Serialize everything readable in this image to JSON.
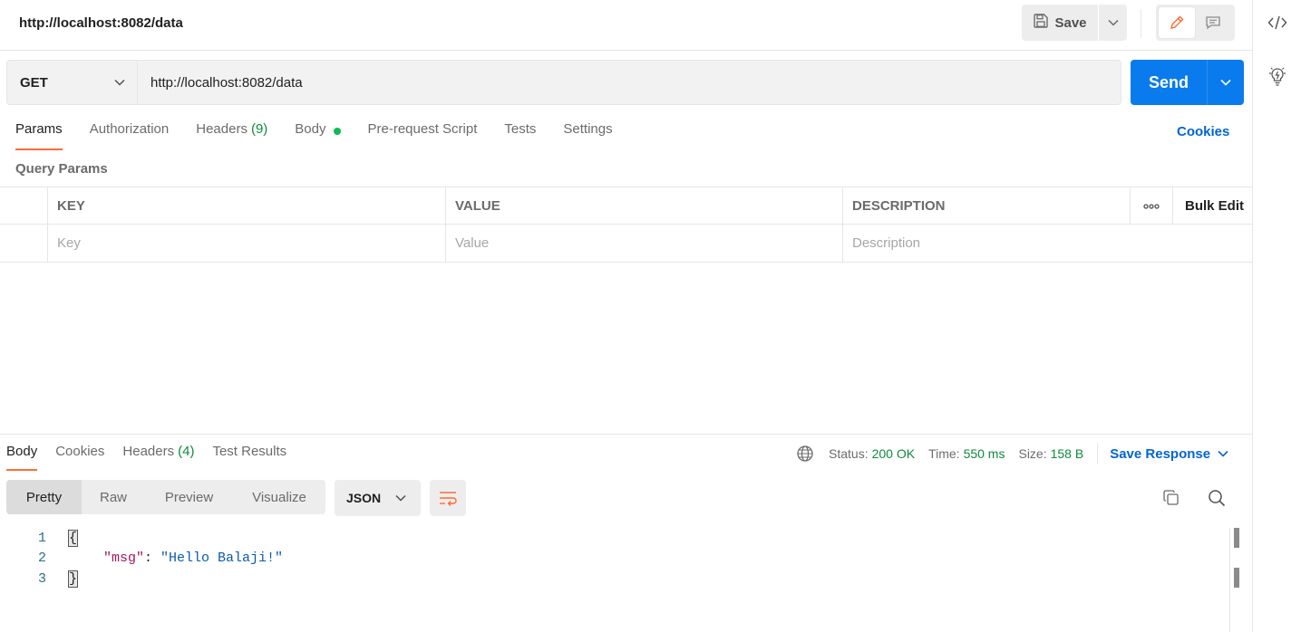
{
  "request": {
    "title": "http://localhost:8082/data",
    "method": "GET",
    "url": "http://localhost:8082/data"
  },
  "toolbar": {
    "save_label": "Save",
    "send_label": "Send"
  },
  "request_tabs": {
    "params": "Params",
    "authorization": "Authorization",
    "headers": "Headers",
    "headers_count": "(9)",
    "body": "Body",
    "pre_request": "Pre-request Script",
    "tests": "Tests",
    "settings": "Settings",
    "cookies": "Cookies"
  },
  "params_table": {
    "section_title": "Query Params",
    "columns": {
      "key": "KEY",
      "value": "VALUE",
      "description": "DESCRIPTION"
    },
    "more": "ooo",
    "bulk_edit": "Bulk Edit",
    "placeholders": {
      "key": "Key",
      "value": "Value",
      "description": "Description"
    }
  },
  "response": {
    "tabs": {
      "body": "Body",
      "cookies": "Cookies",
      "headers": "Headers",
      "headers_count": "(4)",
      "test_results": "Test Results"
    },
    "meta": {
      "status_label": "Status:",
      "status_value": "200 OK",
      "time_label": "Time:",
      "time_value": "550 ms",
      "size_label": "Size:",
      "size_value": "158 B"
    },
    "save_response": "Save Response",
    "view_tabs": [
      "Pretty",
      "Raw",
      "Preview",
      "Visualize"
    ],
    "format": "JSON",
    "code_lines": {
      "n1": "1",
      "n2": "2",
      "n3": "3",
      "open": "{",
      "key": "\"msg\"",
      "colon": ": ",
      "value": "\"Hello Balaji!\"",
      "close": "}"
    }
  },
  "colors": {
    "accent_orange": "#ff6c37",
    "send_blue": "#097bed",
    "link_blue": "#0265d2",
    "status_green": "#0f8a3c"
  }
}
